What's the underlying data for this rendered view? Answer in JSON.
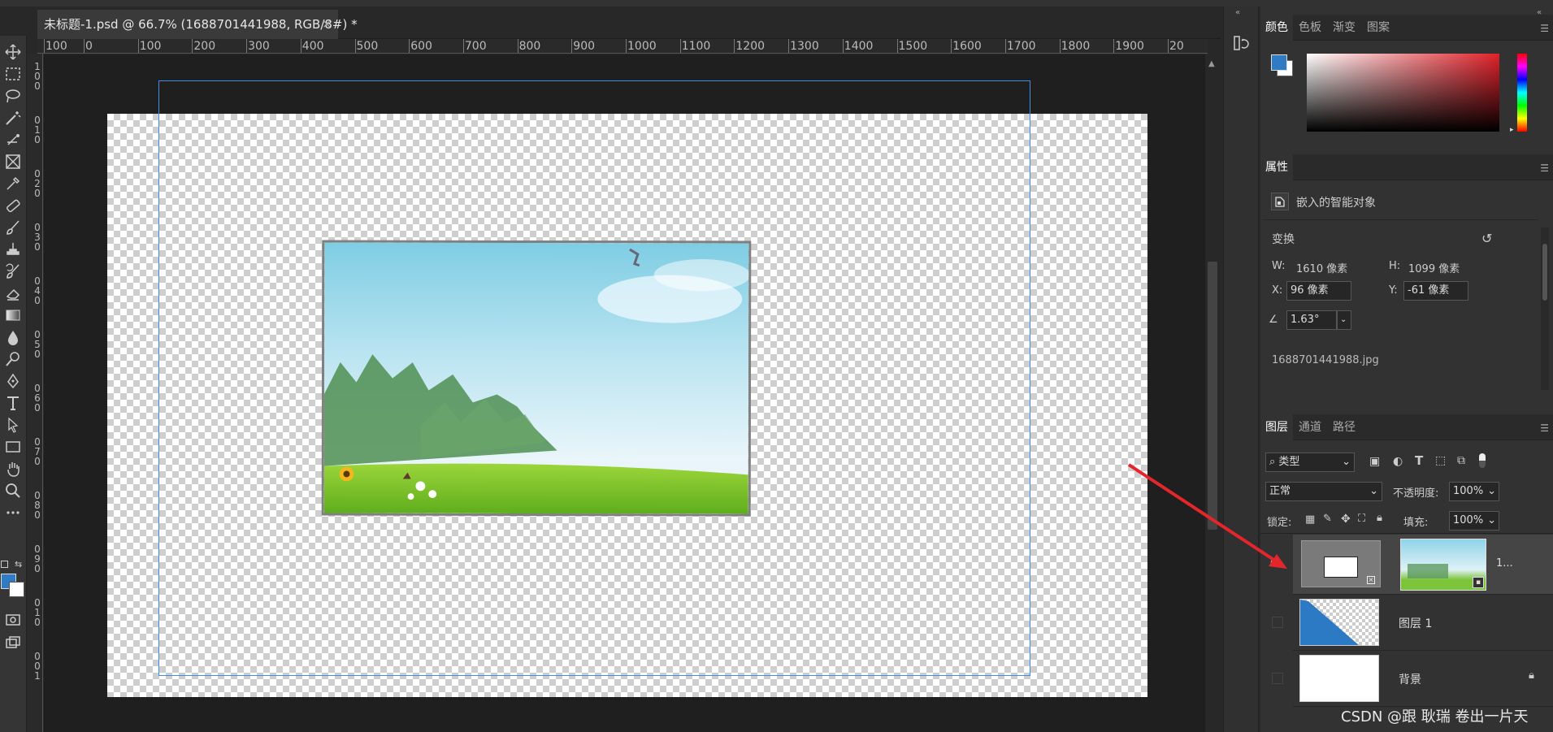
{
  "document_tab": {
    "title": "未标题-1.psd @ 66.7% (1688701441988, RGB/8#) *",
    "close": "×"
  },
  "ruler": {
    "h_labels": [
      "100",
      "0",
      "100",
      "200",
      "300",
      "400",
      "500",
      "600",
      "700",
      "800",
      "900",
      "1000",
      "1100",
      "1200",
      "1300",
      "1400",
      "1500",
      "1600",
      "1700",
      "1800",
      "1900",
      "20"
    ],
    "v_labels": [
      "1",
      "0",
      "0",
      "0",
      "1",
      "0",
      "0",
      "2",
      "0",
      "0",
      "3",
      "0",
      "0",
      "4",
      "0",
      "0",
      "5",
      "0",
      "0",
      "6",
      "0",
      "0",
      "7",
      "0",
      "0",
      "8",
      "0",
      "0",
      "9",
      "0",
      "0",
      "1",
      "0",
      "0",
      "0",
      "1"
    ]
  },
  "color_panel": {
    "tabs": [
      "颜色",
      "色板",
      "渐变",
      "图案"
    ],
    "foreground": "#2f7cc4",
    "background": "#ffffff"
  },
  "properties_panel": {
    "title": "属性",
    "object_type": "嵌入的智能对象",
    "transform_label": "变换",
    "w_label": "W:",
    "w_value": "1610 像素",
    "h_label": "H:",
    "h_value": "1099 像素",
    "x_label": "X:",
    "x_value": "96 像素",
    "y_label": "Y:",
    "y_value": "-61 像素",
    "angle_value": "1.63°",
    "filename": "1688701441988.jpg"
  },
  "layers_panel": {
    "tabs": [
      "图层",
      "通道",
      "路径"
    ],
    "filter_label": "类型",
    "blend_mode": "正常",
    "opacity_label": "不透明度:",
    "opacity_value": "100%",
    "lock_label": "锁定:",
    "fill_label": "填充:",
    "fill_value": "100%",
    "layers": [
      {
        "name": "1...",
        "visible": true,
        "selected": true
      },
      {
        "name": "图层 1",
        "visible": false,
        "selected": false
      },
      {
        "name": "背景",
        "visible": false,
        "selected": false,
        "locked": true
      }
    ]
  },
  "watermark": "CSDN @跟 耿瑞 卷出一片天"
}
